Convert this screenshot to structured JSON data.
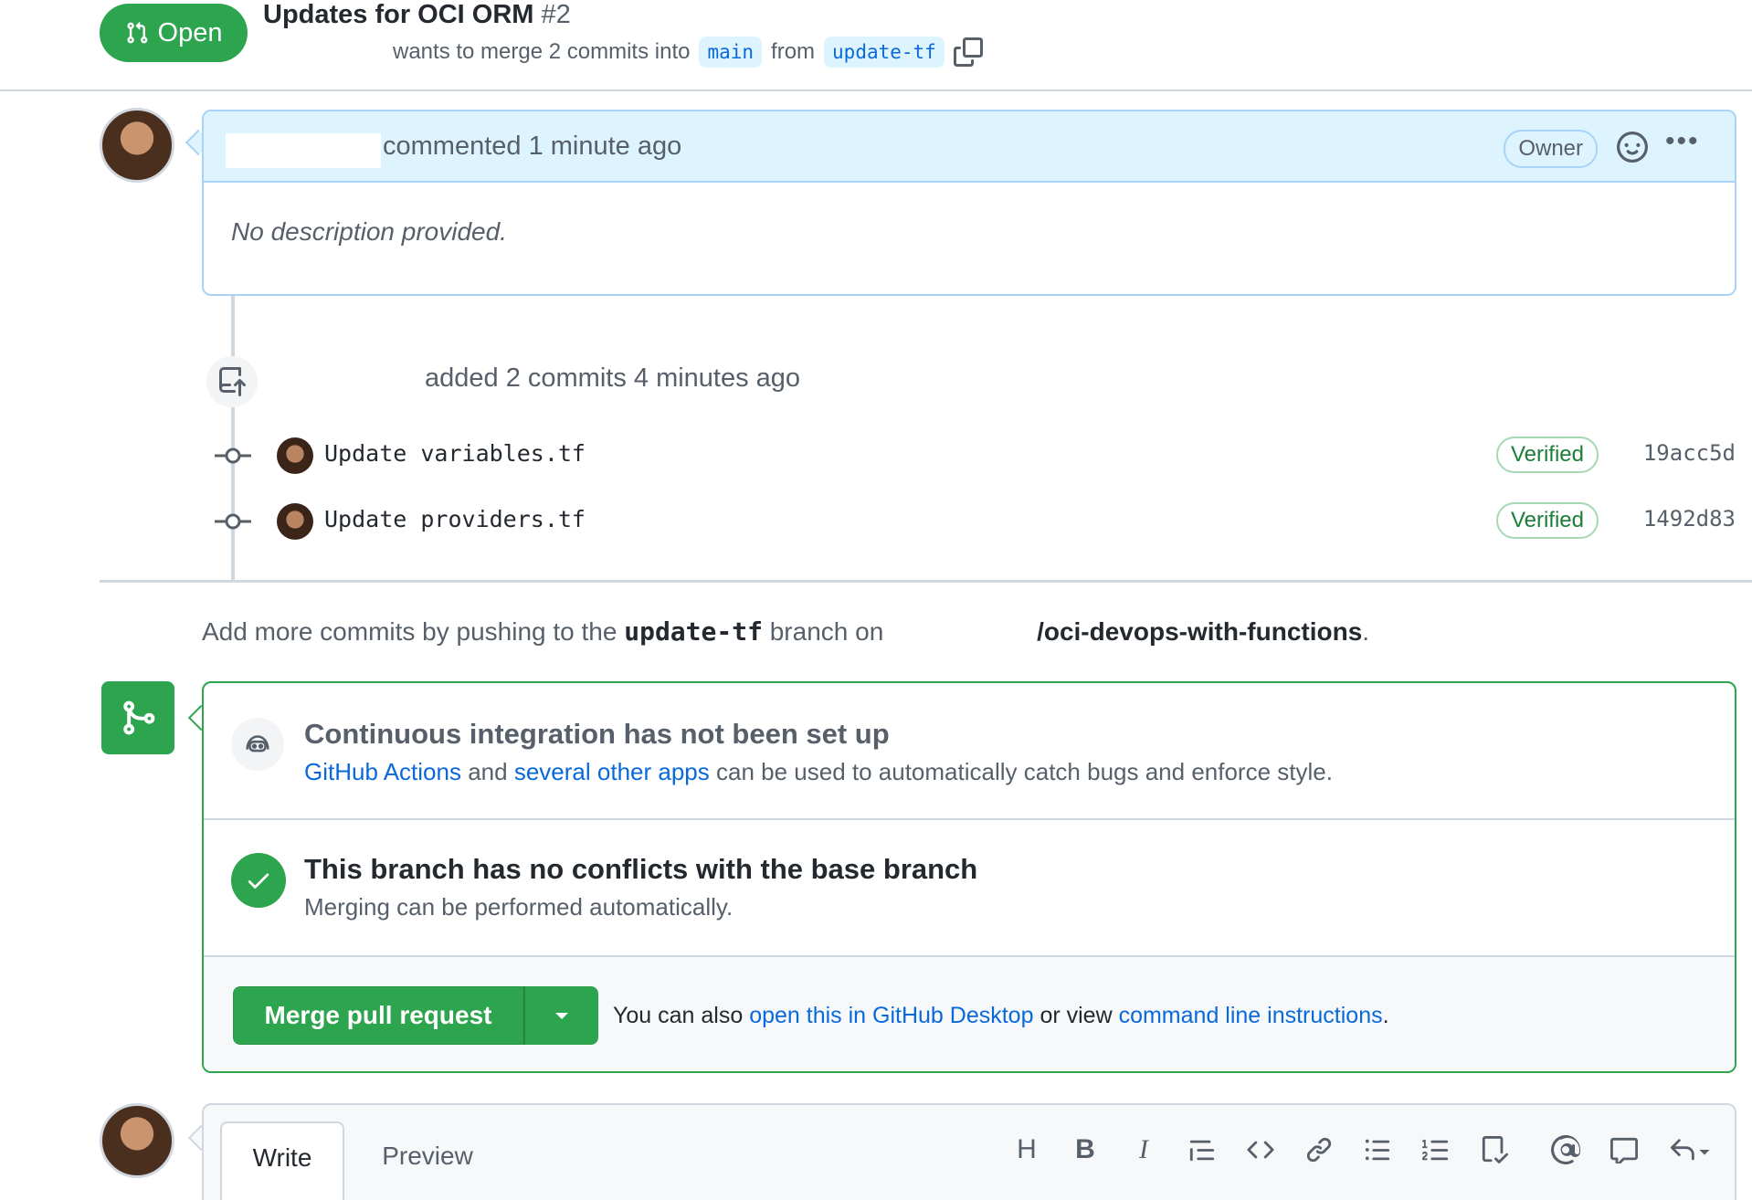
{
  "header": {
    "status_label": "Open",
    "title": "Updates for OCI ORM",
    "number": "#2",
    "merge_text": "wants to merge 2 commits into",
    "base_branch": "main",
    "from_text": "from",
    "head_branch": "update-tf"
  },
  "comment": {
    "meta": "commented 1 minute ago",
    "role_badge": "Owner",
    "body": "No description provided."
  },
  "timeline": {
    "summary": "added 2 commits 4 minutes ago",
    "commits": [
      {
        "message": "Update variables.tf",
        "badge": "Verified",
        "sha": "19acc5d"
      },
      {
        "message": "Update providers.tf",
        "badge": "Verified",
        "sha": "1492d83"
      }
    ]
  },
  "push_hint": {
    "prefix": "Add more commits by pushing to the",
    "branch": "update-tf",
    "middle": "branch on",
    "repo": "/oci-devops-with-functions",
    "suffix": "."
  },
  "merge_box": {
    "ci_title": "Continuous integration has not been set up",
    "ci_link1": "GitHub Actions",
    "ci_and": "and",
    "ci_link2": "several other apps",
    "ci_rest": "can be used to automatically catch bugs and enforce style.",
    "conflict_title": "This branch has no conflicts with the base branch",
    "conflict_desc": "Merging can be performed automatically.",
    "merge_button": "Merge pull request",
    "hint_prefix": "You can also",
    "hint_link1": "open this in GitHub Desktop",
    "hint_middle": "or view",
    "hint_link2": "command line instructions",
    "hint_suffix": "."
  },
  "editor": {
    "tab_write": "Write",
    "tab_preview": "Preview",
    "toolbar_icons": [
      "heading-icon",
      "bold-icon",
      "italic-icon",
      "quote-icon",
      "code-icon",
      "link-icon",
      "unordered-list-icon",
      "ordered-list-icon",
      "task-list-icon",
      "mention-icon",
      "reference-icon",
      "reply-icon"
    ],
    "toolbar_glyphs": {
      "heading": "H",
      "bold": "B",
      "italic": "I"
    }
  },
  "colors": {
    "success": "#2da44e",
    "link": "#0969da",
    "comment_header": "#ddf4ff"
  }
}
